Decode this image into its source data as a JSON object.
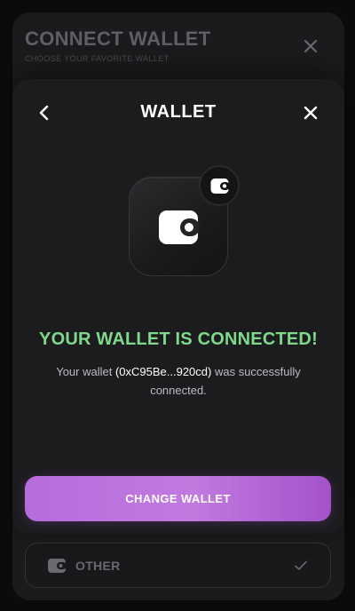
{
  "background_sheet": {
    "title": "CONNECT WALLET",
    "subtitle": "CHOOSE YOUR FAVORITE WALLET",
    "close_icon": "close-icon",
    "option": {
      "label": "OTHER",
      "icon": "wallet-icon",
      "status_icon": "check-icon"
    }
  },
  "modal": {
    "title": "WALLET",
    "back_icon": "chevron-left-icon",
    "close_icon": "close-icon",
    "wallet_icon": "wallet-icon",
    "badge_icon": "wallet-icon",
    "status_heading": "YOUR WALLET IS CONNECTED!",
    "status_prefix": "Your wallet ",
    "wallet_address": "(0xC95Be...920cd)",
    "status_suffix": " was successfully connected.",
    "change_button_label": "CHANGE WALLET"
  },
  "colors": {
    "success": "#7ed98a",
    "accent": "#b66ddc",
    "modal_bg": "#1c1c1e",
    "page_bg": "#0b0b0c"
  }
}
